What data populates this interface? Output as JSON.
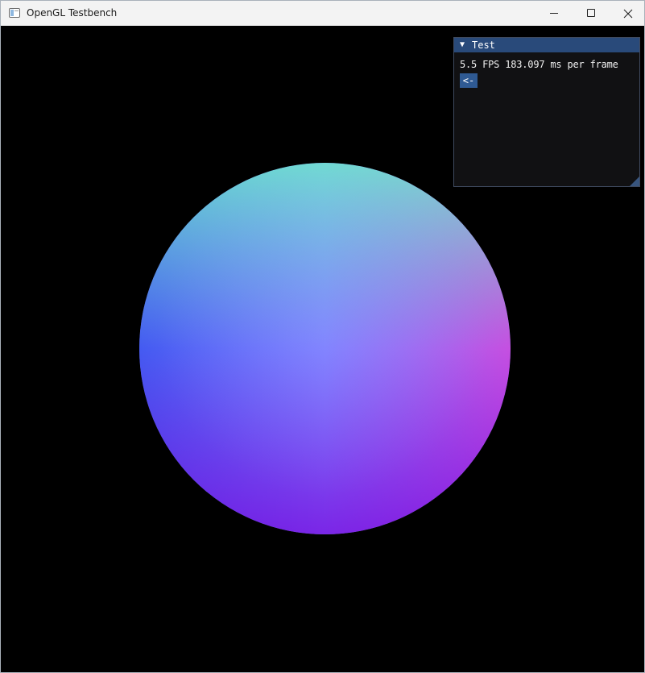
{
  "window": {
    "title": "OpenGL Testbench",
    "controls": {
      "minimize": "minimize-icon",
      "maximize": "maximize-icon",
      "close": "close-icon"
    }
  },
  "viewport": {
    "background_color": "#000000",
    "scene_object": "normal-shaded-sphere"
  },
  "debug_panel": {
    "title": "Test",
    "collapse_icon": "▼",
    "fps_text": "5.5 FPS 183.097 ms per frame",
    "back_button_label": "<-",
    "title_color": "#294a7a",
    "button_color": "#2f5a93"
  }
}
